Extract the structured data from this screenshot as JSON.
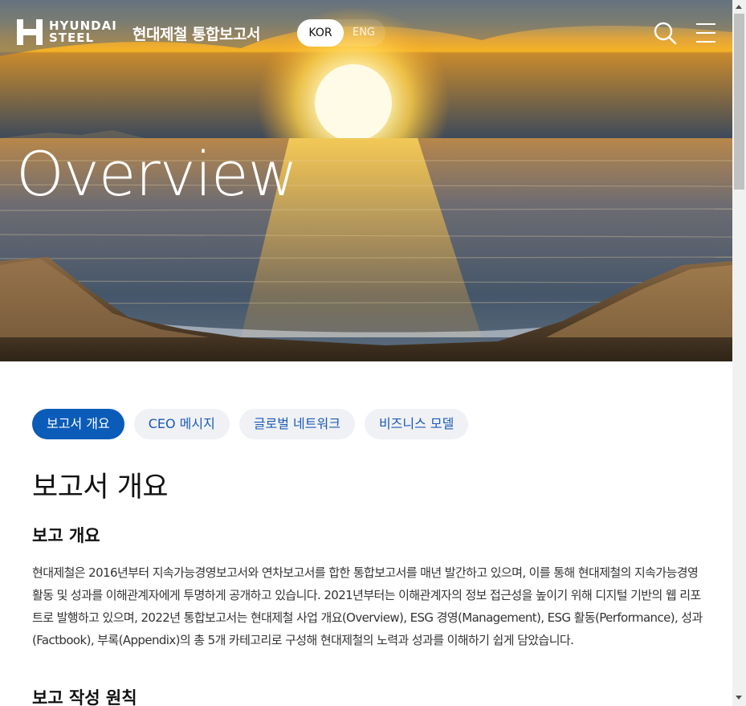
{
  "header": {
    "logo_line1": "HYUNDAI",
    "logo_line2": "STEEL",
    "site_title": "현대제철 통합보고서",
    "lang_kor": "KOR",
    "lang_eng": "ENG",
    "search_icon": "search-icon",
    "menu_icon": "hamburger-menu-icon"
  },
  "hero": {
    "title": "Overview"
  },
  "tabs": [
    {
      "label": "보고서 개요",
      "active": true
    },
    {
      "label": "CEO 메시지",
      "active": false
    },
    {
      "label": "글로벌 네트워크",
      "active": false
    },
    {
      "label": "비즈니스 모델",
      "active": false
    }
  ],
  "main": {
    "page_title": "보고서 개요",
    "section1_title": "보고 개요",
    "section1_text": "현대제철은 2016년부터 지속가능경영보고서와 연차보고서를 합한 통합보고서를 매년 발간하고 있으며, 이를 통해 현대제철의 지속가능경영 활동 및 성과를 이해관계자에게 투명하게 공개하고 있습니다. 2021년부터는 이해관계자의 정보 접근성을 높이기 위해 디지털 기반의 웹 리포트로 발행하고 있으며, 2022년 통합보고서는 현대제철 사업 개요(Overview), ESG 경영(Management), ESG 활동(Performance), 성과(Factbook), 부록(Appendix)의 총 5개 카테고리로 구성해 현대제철의 노력과 성과를 이해하기 쉽게 담았습니다.",
    "section2_title": "보고 작성 원칙"
  },
  "colors": {
    "primary": "#0b5cb8",
    "tab_bg": "#f0f1f4",
    "tab_text": "#1a5ab8"
  }
}
